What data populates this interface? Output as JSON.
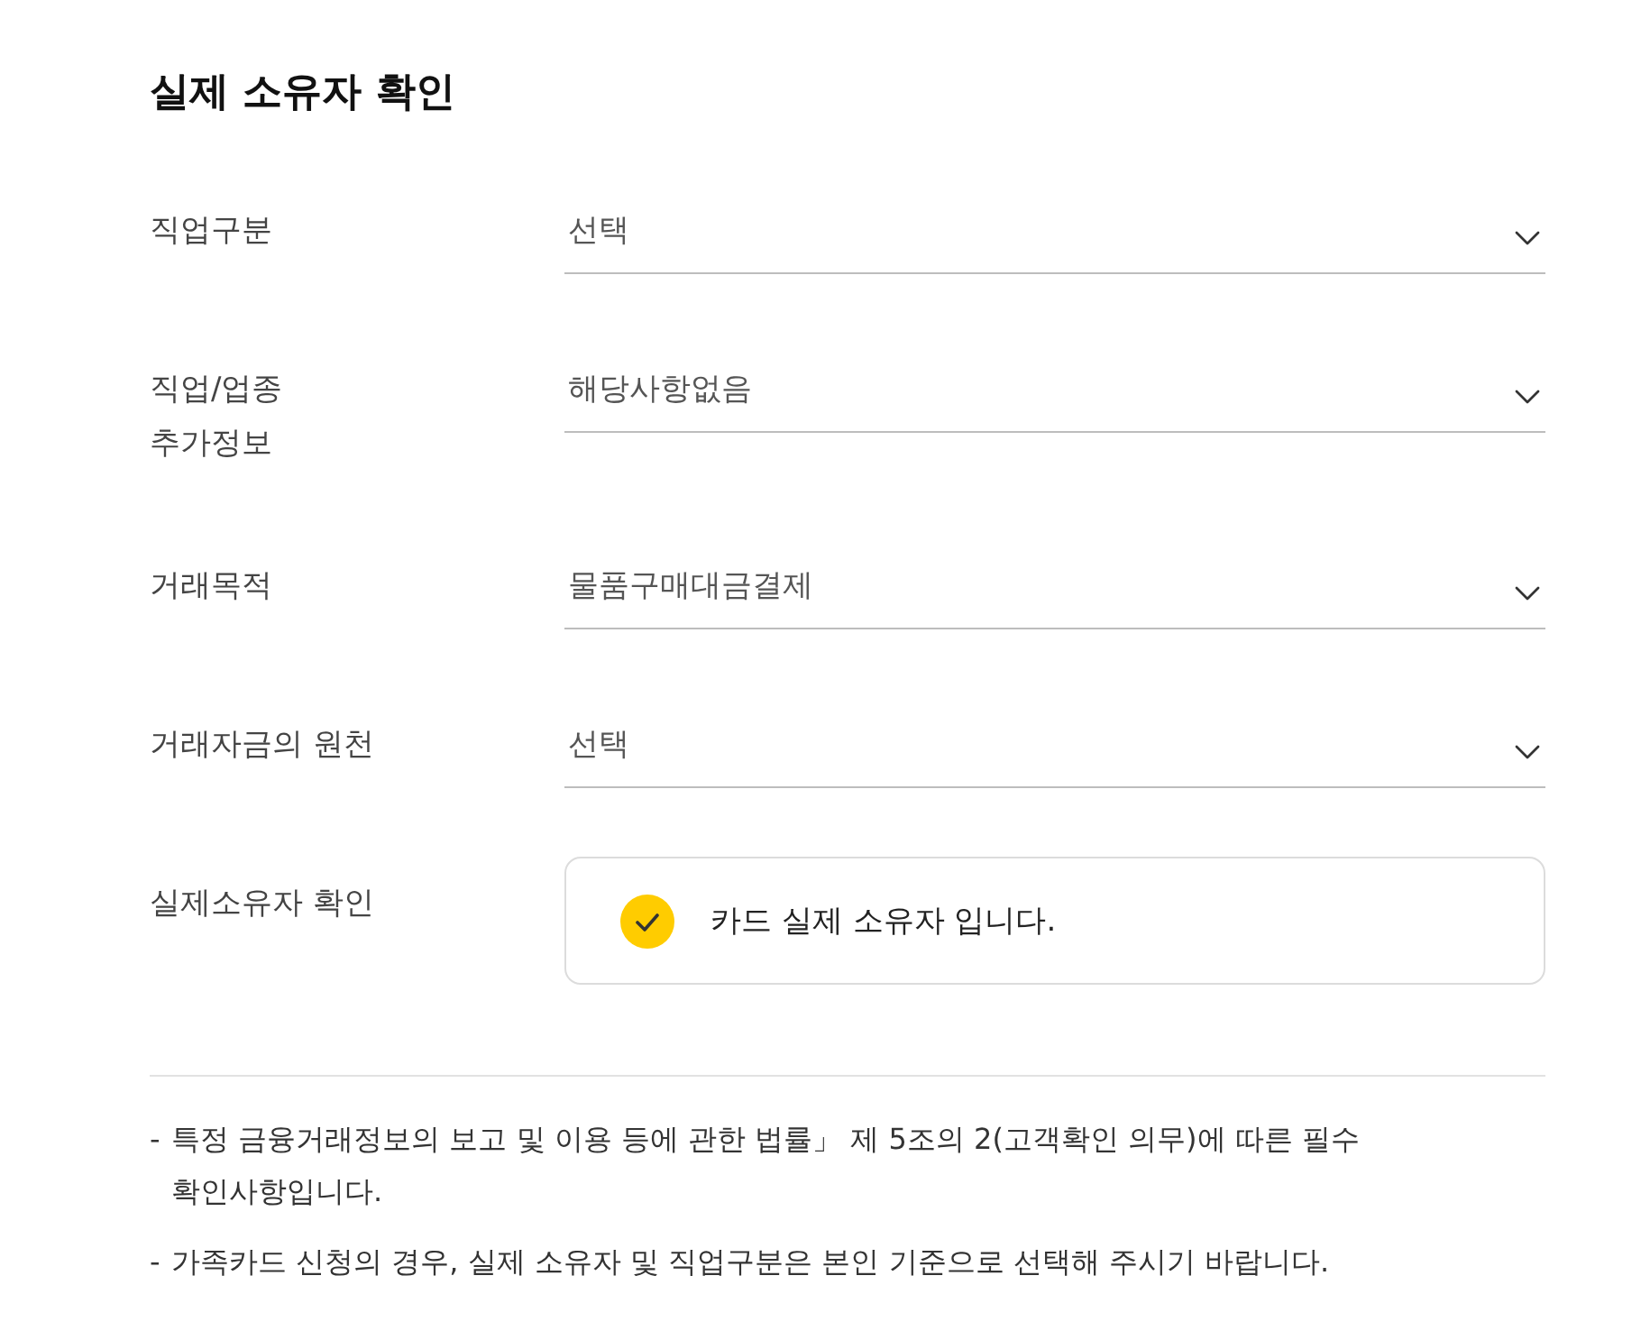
{
  "title": "실제 소유자 확인",
  "fields": [
    {
      "kind": "select",
      "label": "직업구분",
      "value": "선택"
    },
    {
      "kind": "select",
      "label": "직업/업종\n추가정보",
      "value": "해당사항없음"
    },
    {
      "kind": "select",
      "label": "거래목적",
      "value": "물품구매대금결제"
    },
    {
      "kind": "select",
      "label": "거래자금의 원천",
      "value": "선택"
    },
    {
      "kind": "checkbox",
      "label": "실제소유자 확인",
      "text": "카드 실제 소유자 입니다.",
      "checked": true
    }
  ],
  "notes": [
    {
      "bullet": "-",
      "text": "특정 금융거래정보의 보고 및 이용 등에 관한 법률」 제 5조의 2(고객확인 의무)에 따른 필수 확인사항입니다."
    },
    {
      "bullet": "-",
      "text": "가족카드 신청의 경우, 실제 소유자 및 직업구분은 본인 기준으로 선택해 주시기 바랍니다."
    }
  ]
}
